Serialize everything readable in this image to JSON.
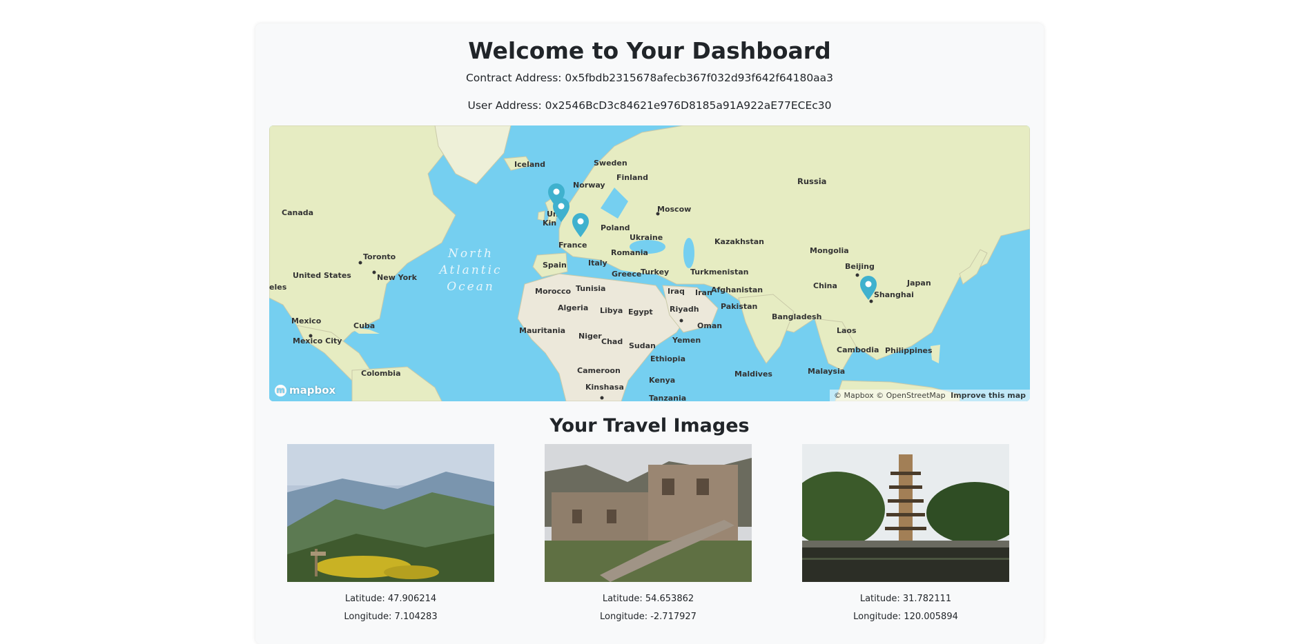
{
  "header": {
    "title": "Welcome to Your Dashboard",
    "contract_address": "Contract Address: 0x5fbdb2315678afecb367f032d93f642f64180aa3",
    "user_address": "User Address: 0x2546BcD3c84621e976D8185a91A922aE77ECEc30"
  },
  "map": {
    "ocean_label": [
      "North",
      "Atlantic",
      "Ocean"
    ],
    "labels": [
      {
        "text": "Iceland"
      },
      {
        "text": "Sweden"
      },
      {
        "text": "Finland"
      },
      {
        "text": "Norway"
      },
      {
        "text": "Russia"
      },
      {
        "text": "Moscow"
      },
      {
        "text": "Canada"
      },
      {
        "text": "Toronto"
      },
      {
        "text": "United States"
      },
      {
        "text": "New York"
      },
      {
        "text": "eles"
      },
      {
        "text": "Poland"
      },
      {
        "text": "Ukraine"
      },
      {
        "text": "Kazakhstan"
      },
      {
        "text": "Mongolia"
      },
      {
        "text": "Romania"
      },
      {
        "text": "Spain"
      },
      {
        "text": "Italy"
      },
      {
        "text": "Turkey"
      },
      {
        "text": "Turkmenistan"
      },
      {
        "text": "Beijing"
      },
      {
        "text": "Greece"
      },
      {
        "text": "Morocco"
      },
      {
        "text": "Tunisia"
      },
      {
        "text": "Iraq"
      },
      {
        "text": "Iran"
      },
      {
        "text": "Afghanistan"
      },
      {
        "text": "China"
      },
      {
        "text": "Japan"
      },
      {
        "text": "Shanghai"
      },
      {
        "text": "Algeria"
      },
      {
        "text": "Libya"
      },
      {
        "text": "Egypt"
      },
      {
        "text": "Riyadh"
      },
      {
        "text": "Pakistan"
      },
      {
        "text": "Mexico"
      },
      {
        "text": "Cuba"
      },
      {
        "text": "Bangladesh"
      },
      {
        "text": "Mauritania"
      },
      {
        "text": "Niger"
      },
      {
        "text": "Oman"
      },
      {
        "text": "Chad"
      },
      {
        "text": "Sudan"
      },
      {
        "text": "Yemen"
      },
      {
        "text": "Laos"
      },
      {
        "text": "Mexico City"
      },
      {
        "text": "Ethiopia"
      },
      {
        "text": "Cambodia"
      },
      {
        "text": "Philippines"
      },
      {
        "text": "Colombia"
      },
      {
        "text": "Cameroon"
      },
      {
        "text": "Maldives"
      },
      {
        "text": "Malaysia"
      },
      {
        "text": "Kenya"
      },
      {
        "text": "Kinshasa"
      },
      {
        "text": "Tanzania"
      },
      {
        "text": "France"
      },
      {
        "text": "Kin"
      },
      {
        "text": "Uni"
      }
    ],
    "logo": "mapbox",
    "attribution": "© Mapbox © OpenStreetMap",
    "improve_link": "Improve this map",
    "marker_color": "#3fb1ce",
    "markers": [
      {
        "lat": 54.653862,
        "lon": -2.717927
      },
      {
        "lat": 52.8,
        "lon": -1.6
      },
      {
        "lat": 47.906214,
        "lon": 7.104283
      },
      {
        "lat": 31.782111,
        "lon": 120.005894
      }
    ]
  },
  "gallery": {
    "title": "Your Travel Images",
    "items": [
      {
        "latitude": "Latitude: 47.906214",
        "longitude": "Longitude: 7.104283",
        "scene": "mountain-landscape"
      },
      {
        "latitude": "Latitude: 54.653862",
        "longitude": "Longitude: -2.717927",
        "scene": "castle-ruins"
      },
      {
        "latitude": "Latitude: 31.782111",
        "longitude": "Longitude: 120.005894",
        "scene": "pagoda-lake"
      }
    ]
  },
  "colors": {
    "ocean": "#75cff0",
    "land": "#e6ecc2",
    "land_africa": "#ece8da",
    "marker": "#3fb1ce"
  }
}
